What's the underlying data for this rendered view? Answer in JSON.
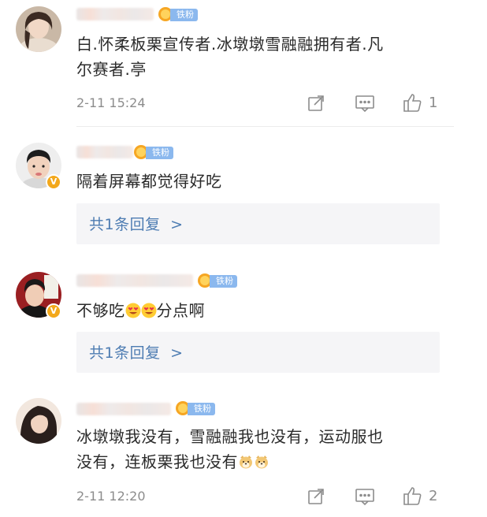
{
  "fan_badge_label": "铁粉",
  "colors": {
    "accent_link": "#4d7cb2",
    "fan_tag": "#8bb8ee",
    "verified": "#f3a81b",
    "meta": "#8c8c8c"
  },
  "comments": [
    {
      "text_line1": "白.怀柔板栗宣传者.冰墩墩雪融融拥有者.凡",
      "text_line2": "尔赛者.亭",
      "time": "2-11 15:24",
      "like_count": "1"
    },
    {
      "text": "隔着屏幕都觉得好吃",
      "reply_label": "共1条回复",
      "reply_chevron": ">"
    },
    {
      "text_before": "不够吃",
      "emoji_icons": [
        "heart-eyes-face-icon",
        "heart-eyes-face-icon"
      ],
      "text_after": "分点啊",
      "reply_label": "共1条回复",
      "reply_chevron": ">"
    },
    {
      "text_line1": "冰墩墩我没有，雪融融我也没有，运动服也",
      "text_line2": "没有，连板栗我也没有",
      "emoji_icons": [
        "doge-face-icon",
        "doge-face-icon"
      ],
      "time": "2-11 12:20",
      "like_count": "2"
    }
  ]
}
